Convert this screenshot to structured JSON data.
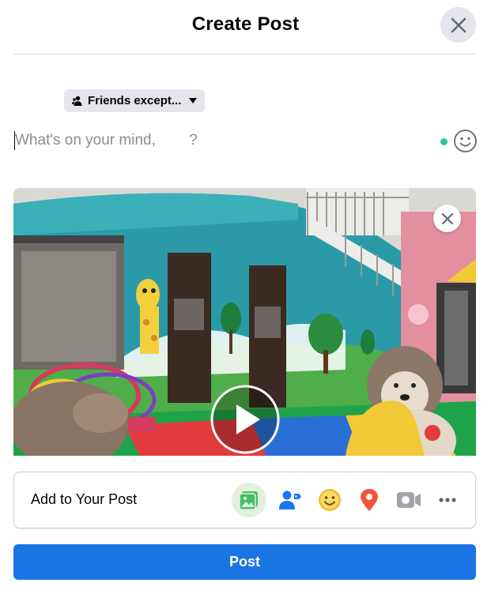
{
  "dialog": {
    "title": "Create Post"
  },
  "audience": {
    "label": "Friends except..."
  },
  "composer": {
    "placeholder": "What's on your mind,        ?"
  },
  "add_to_post": {
    "label": "Add to Your Post",
    "icons": [
      "photo-video-icon",
      "tag-people-icon",
      "feeling-activity-icon",
      "check-in-icon",
      "live-video-icon",
      "more-icon"
    ]
  },
  "actions": {
    "post_label": "Post"
  },
  "colors": {
    "primary": "#1b74e4",
    "photo_green": "#45bd62",
    "tag_blue": "#1877f2",
    "feeling_yellow": "#f7b928",
    "checkin_red": "#f5533d",
    "live_gray": "#a1a4a8",
    "online_dot": "#31c48d"
  }
}
